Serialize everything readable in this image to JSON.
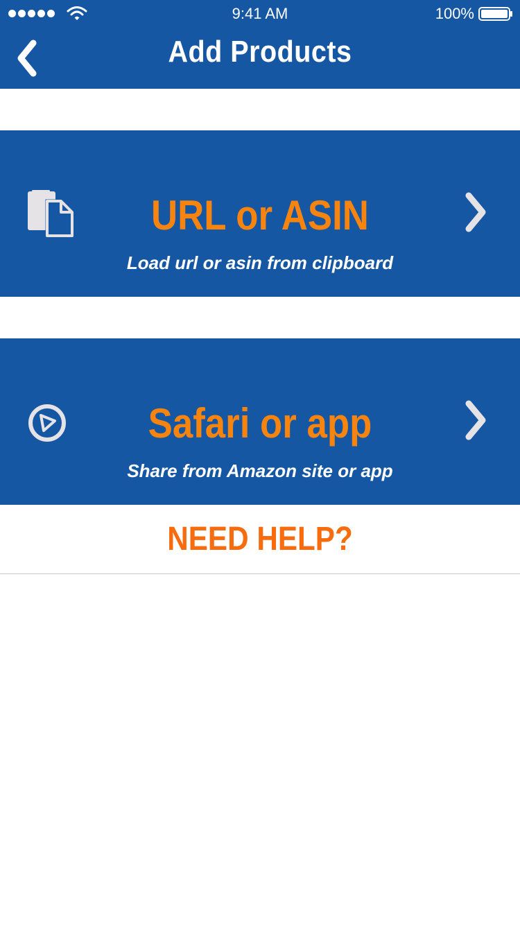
{
  "status_bar": {
    "time": "9:41 AM",
    "battery_percent": "100%",
    "signal_bars": 5
  },
  "header": {
    "title": "Add Products",
    "back_icon": "chevron-left-icon"
  },
  "options": [
    {
      "title": "URL or ASIN",
      "subtitle": "Load url or asin from clipboard",
      "icon": "clipboard-icon"
    },
    {
      "title": "Safari or app",
      "subtitle": "Share from Amazon site or app",
      "icon": "compass-icon"
    }
  ],
  "help": {
    "label": "NEED HELP?"
  },
  "colors": {
    "brand_blue": "#1657a4",
    "accent_orange": "#f7840f",
    "help_orange": "#f76c0f",
    "icon_gray": "#e6e3e6"
  }
}
